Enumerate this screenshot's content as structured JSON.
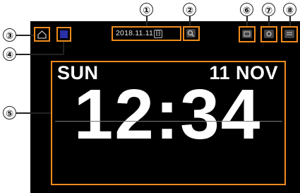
{
  "callouts": {
    "c1": "①",
    "c2": "②",
    "c3": "③",
    "c4": "④",
    "c5": "⑤",
    "c6": "⑥",
    "c7": "⑦",
    "c8": "⑧"
  },
  "status_bar": {
    "date": "2018.11.11",
    "weekday_box": "日"
  },
  "clock": {
    "day": "SUN",
    "date": "11 NOV",
    "time": "12:34"
  },
  "icons": {
    "home": "home-icon",
    "color_square": "color-square-icon",
    "search": "search-icon",
    "display": "display-icon",
    "settings": "settings-icon",
    "menu": "menu-icon"
  },
  "colors": {
    "highlight": "#f08c1e",
    "screen_bg": "#000000",
    "color_square": "#2b2fa8"
  }
}
